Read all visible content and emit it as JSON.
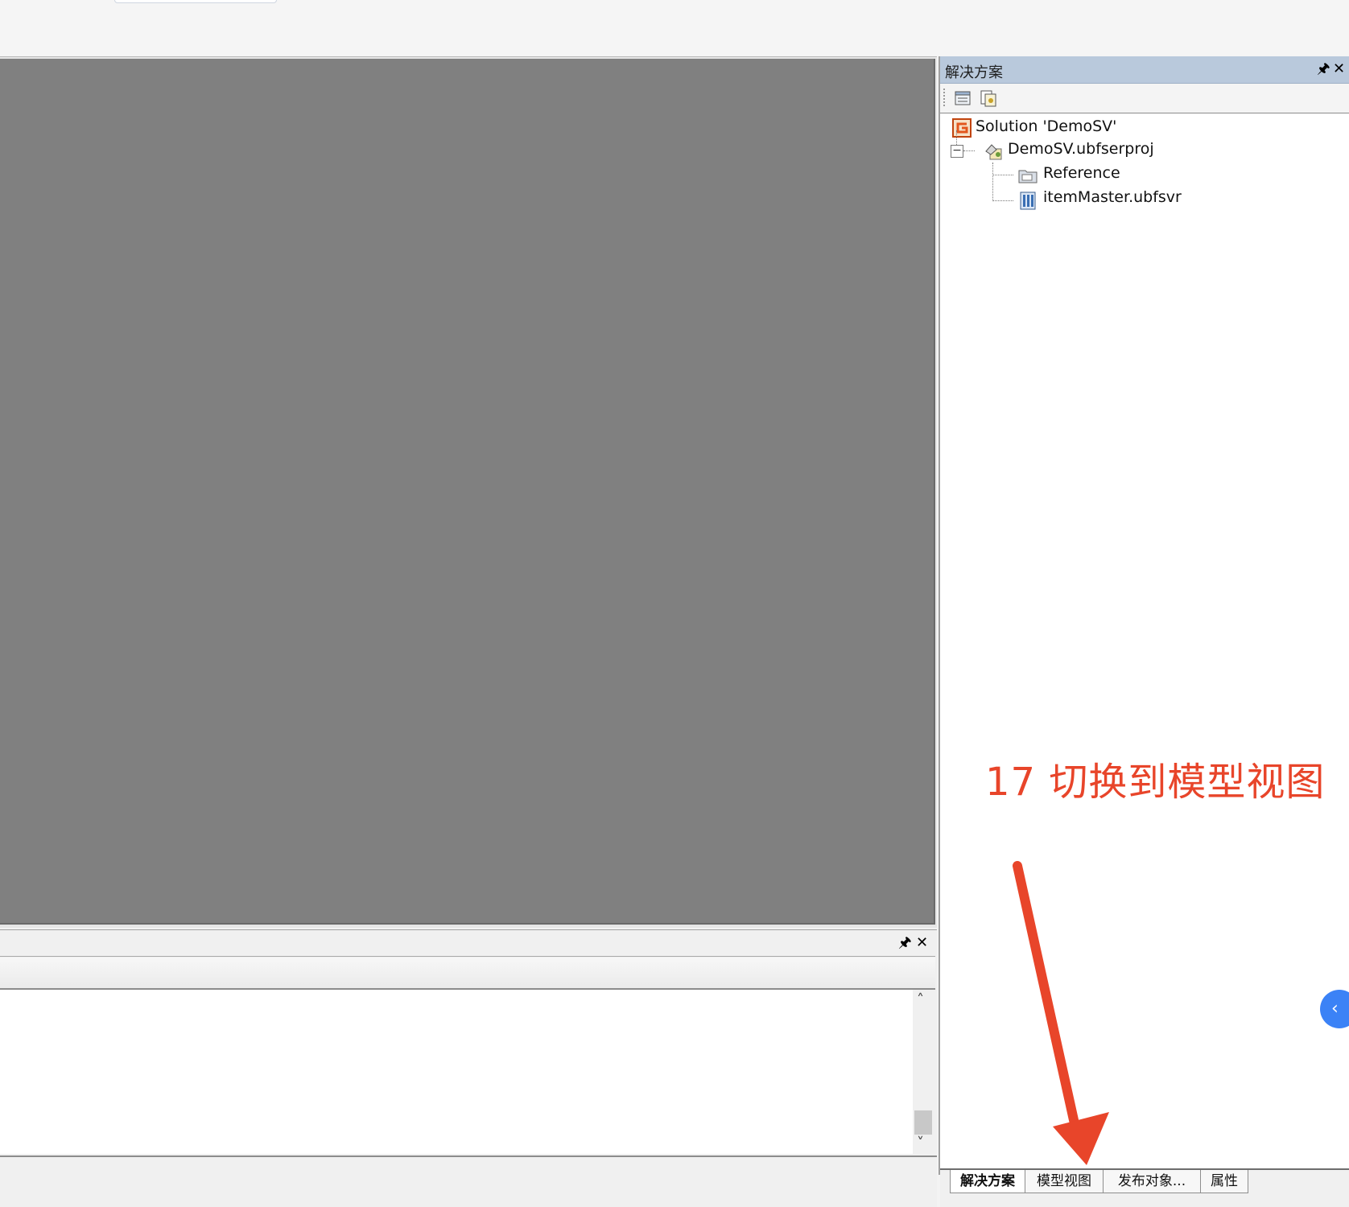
{
  "annotation": {
    "text": "17 切换到模型视图",
    "color": "#e8452a"
  },
  "solution_panel": {
    "title": "解决方案",
    "pin_label": "🖈",
    "close_label": "✕",
    "tree": {
      "solution": "Solution 'DemoSV'",
      "project": "DemoSV.ubfserproj",
      "reference": "Reference",
      "item": "itemMaster.ubfsvr"
    },
    "expander": "−"
  },
  "output_panel": {
    "pin_label": "🖈",
    "close_label": "✕",
    "scroll_up": "˄",
    "scroll_down": "˅"
  },
  "bottom_tabs": [
    {
      "label": "解决方案",
      "active": true
    },
    {
      "label": "模型视图",
      "active": false
    },
    {
      "label": "发布对象...",
      "active": false
    },
    {
      "label": "属性",
      "active": false
    }
  ],
  "side_toggle_glyph": "‹",
  "colors": {
    "document_bg": "#808080",
    "title_bar": "#b9c9dc",
    "accent": "#3b82f6"
  }
}
